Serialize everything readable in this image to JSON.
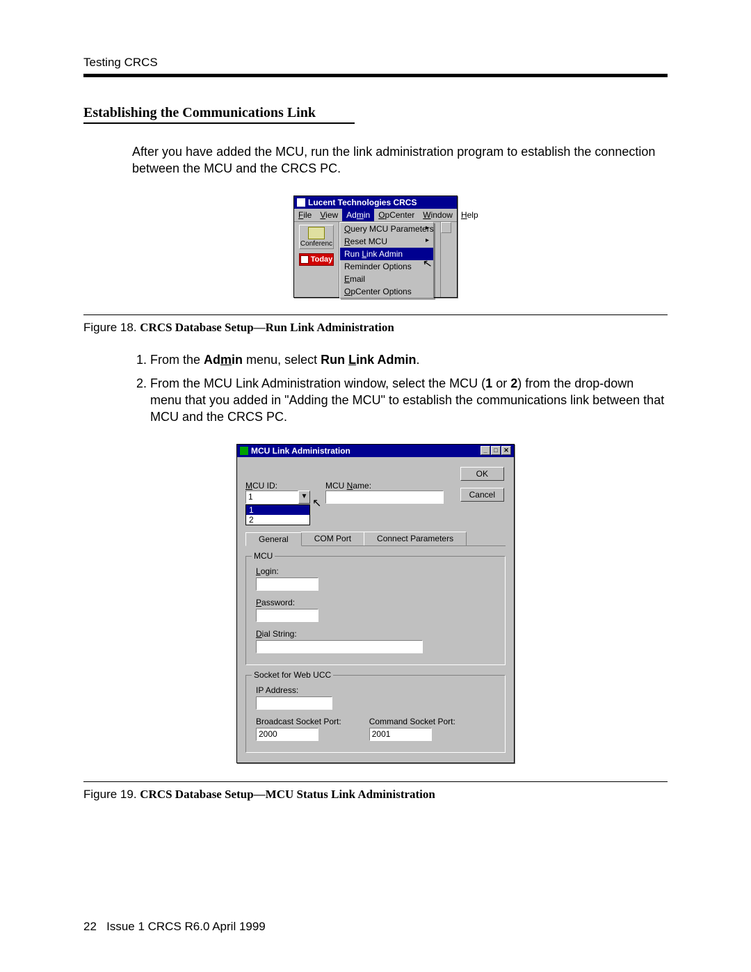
{
  "running_head": "Testing CRCS",
  "section_title": "Establishing the Communications Link",
  "intro_para": "After you have added the MCU, run the link administration program to establish the connection between the MCU and the CRCS PC.",
  "fig18": {
    "caption_prefix": "Figure 18. ",
    "caption_title": "CRCS Database Setup—Run Link Administration",
    "window_title": "Lucent Technologies CRCS",
    "menus": {
      "file": "File",
      "view": "View",
      "admin": "Admin",
      "opcenter": "OpCenter",
      "window": "Window",
      "help": "Help"
    },
    "toolbar": {
      "conferenc": "Conferenc",
      "today": "Today"
    },
    "dropdown": {
      "query": "Query MCU Parameters",
      "reset": "Reset MCU",
      "runlink": "Run Link Admin",
      "reminder": "Reminder Options",
      "email": "Email",
      "opcenter": "OpCenter Options"
    }
  },
  "steps": {
    "s1_pre": "From the ",
    "s1_admin": "Admin",
    "s1_mid": " menu, select ",
    "s1_runlink": "Run Link Admin",
    "s1_post": ".",
    "s2": "From the MCU Link Administration window, select the MCU (1 or 2) from the drop-down menu that you added in \"Adding the MCU\" to establish the communications link between that MCU and the CRCS PC."
  },
  "fig19": {
    "caption_prefix": "Figure 19. ",
    "caption_title": "CRCS Database Setup—MCU Status Link Administration",
    "window_title": "MCU Link Administration",
    "ok": "OK",
    "cancel": "Cancel",
    "mcu_id_label": "MCU ID:",
    "mcu_id_value": "1",
    "mcu_id_options": {
      "o1": "1",
      "o2": "2"
    },
    "mcu_name_label": "MCU Name:",
    "tabs": {
      "general": "General",
      "comport": "COM Port",
      "connect": "Connect Parameters"
    },
    "mcu_group": "MCU",
    "login_label": "Login:",
    "password_label": "Password:",
    "dial_label": "Dial String:",
    "socket_group": "Socket for Web UCC",
    "ip_label": "IP Address:",
    "bcast_label": "Broadcast Socket Port:",
    "bcast_value": "2000",
    "cmd_label": "Command Socket Port:",
    "cmd_value": "2001"
  },
  "footer": {
    "page_no": "22",
    "issue": "Issue 1 CRCS R6.0  April 1999"
  }
}
